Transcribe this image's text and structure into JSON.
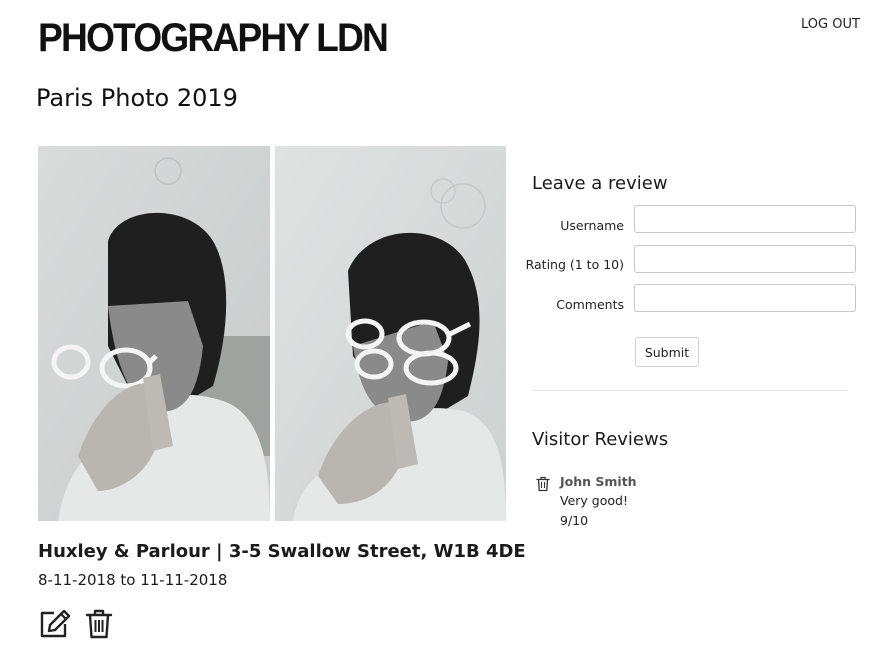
{
  "header": {
    "brand": "PHOTOGRAPHY LDN",
    "logout_label": "LOG OUT"
  },
  "exhibition": {
    "title": "Paris Photo 2019",
    "venue": "Huxley & Parlour | 3-5 Swallow Street, W1B 4DE",
    "dates": "8-11-2018 to 11-11-2018",
    "actions": {
      "edit_icon": "edit-icon",
      "delete_icon": "trash-icon"
    }
  },
  "review_form": {
    "heading": "Leave a review",
    "fields": {
      "username": {
        "label": "Username",
        "value": ""
      },
      "rating": {
        "label": "Rating (1 to 10)",
        "value": ""
      },
      "comments": {
        "label": "Comments",
        "value": ""
      }
    },
    "submit_label": "Submit"
  },
  "visitor_reviews": {
    "heading": "Visitor Reviews",
    "items": [
      {
        "name": "John Smith",
        "comment": "Very good!",
        "rating": "9/10",
        "delete_icon": "trash-icon"
      }
    ]
  }
}
